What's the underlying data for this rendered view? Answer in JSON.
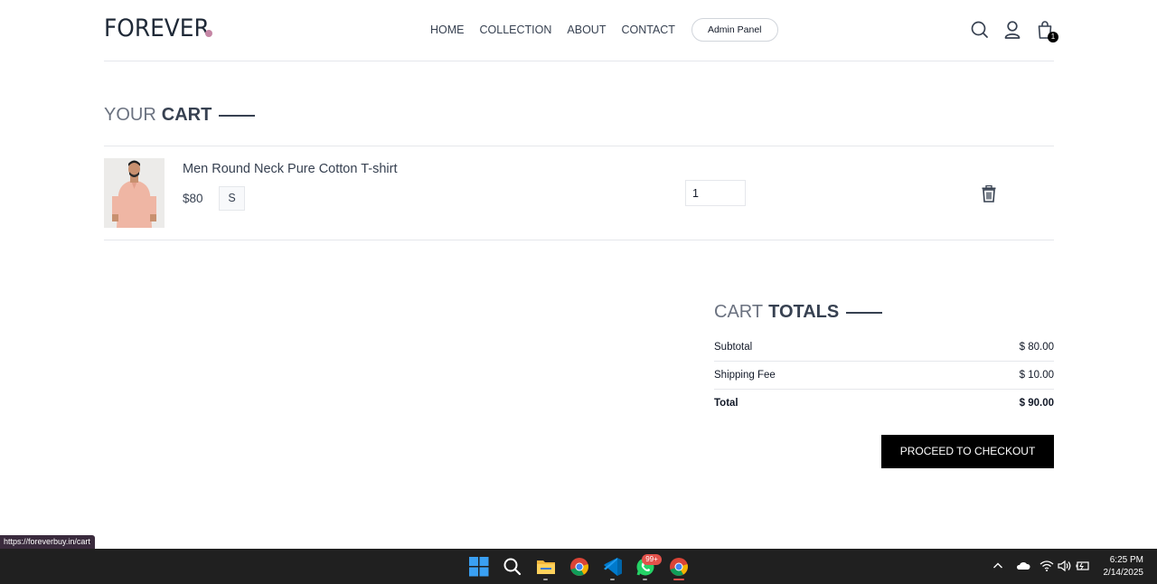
{
  "header": {
    "logo_text": "FOREVER",
    "nav": [
      "HOME",
      "COLLECTION",
      "ABOUT",
      "CONTACT"
    ],
    "admin_label": "Admin Panel",
    "cart_count": "1"
  },
  "cart": {
    "title_light": "YOUR",
    "title_dark": "CART",
    "items": [
      {
        "name": "Men Round Neck Pure Cotton T-shirt",
        "price": "$80",
        "size": "S",
        "quantity": "1"
      }
    ]
  },
  "totals": {
    "title_light": "CART",
    "title_dark": "TOTALS",
    "subtotal_label": "Subtotal",
    "subtotal_value": "$ 80.00",
    "shipping_label": "Shipping Fee",
    "shipping_value": "$ 10.00",
    "total_label": "Total",
    "total_value": "$ 90.00",
    "checkout_label": "PROCEED TO CHECKOUT"
  },
  "status_bar": {
    "url": "https://foreverbuy.in/cart"
  },
  "taskbar": {
    "whatsapp_badge": "99+",
    "time": "6:25 PM",
    "date": "2/14/2025"
  },
  "colors": {
    "accent_dot": "#c586a5",
    "button_bg": "#000000"
  }
}
